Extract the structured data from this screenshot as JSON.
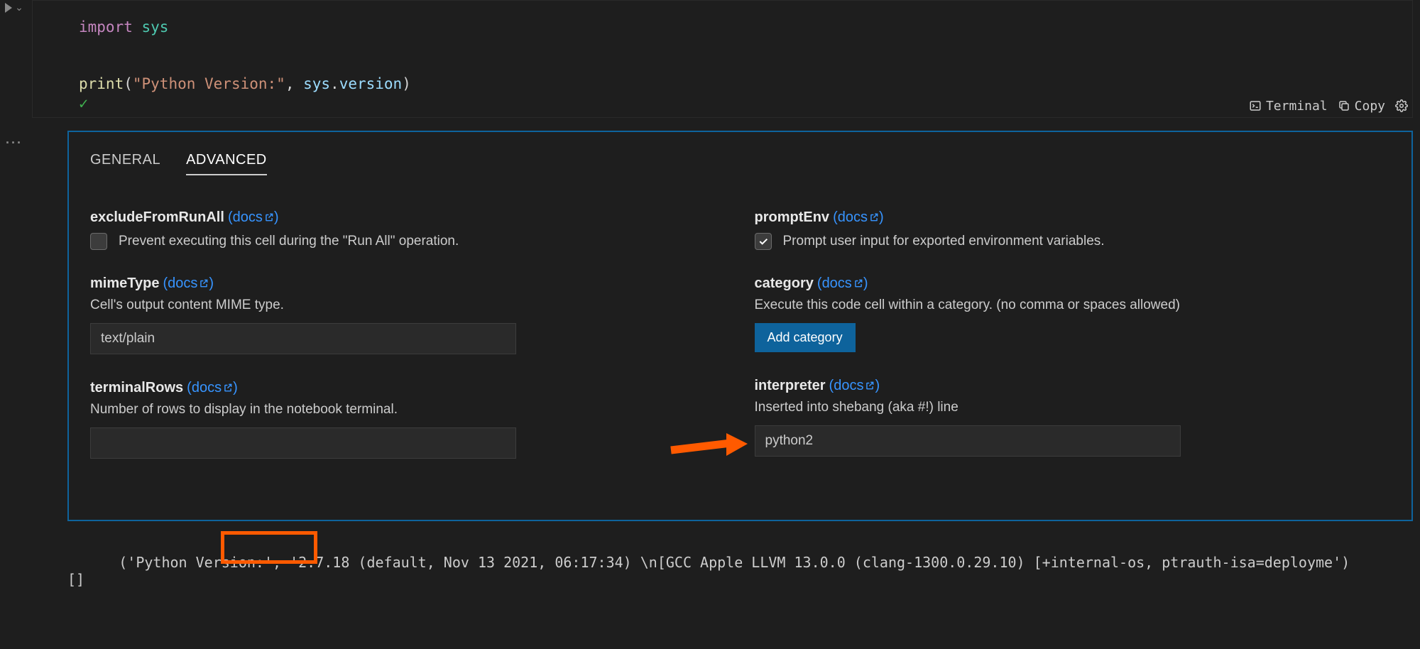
{
  "gutter": {
    "play_label": "run",
    "dropdown_label": "run-options"
  },
  "code": {
    "line1_kw": "import",
    "line1_mod": "sys",
    "line2_fn": "print",
    "line2_str": "\"Python Version:\"",
    "line2_var": "sys",
    "line2_attr": "version"
  },
  "cell_actions": {
    "terminal": "Terminal",
    "copy": "Copy"
  },
  "tabs": {
    "general": "GENERAL",
    "advanced": "ADVANCED"
  },
  "docs_label": "docs",
  "left": {
    "excludeFromRunAll": {
      "title": "excludeFromRunAll",
      "desc": "Prevent executing this cell during the \"Run All\" operation.",
      "checked": false
    },
    "mimeType": {
      "title": "mimeType",
      "desc": "Cell's output content MIME type.",
      "value": "text/plain"
    },
    "terminalRows": {
      "title": "terminalRows",
      "desc": "Number of rows to display in the notebook terminal.",
      "value": ""
    }
  },
  "right": {
    "promptEnv": {
      "title": "promptEnv",
      "desc": "Prompt user input for exported environment variables.",
      "checked": true
    },
    "category": {
      "title": "category",
      "desc": "Execute this code cell within a category. (no comma or spaces allowed)",
      "button": "Add category"
    },
    "interpreter": {
      "title": "interpreter",
      "desc": "Inserted into shebang (aka #!) line",
      "value": "python2"
    }
  },
  "output": {
    "line1": "('Python Version:', '2.7.18 (default, Nov 13 2021, 06:17:34) \\n[GCC Apple LLVM 13.0.0 (clang-1300.0.29.10) [+internal-os, ptrauth-isa=deployme')",
    "line2": "[]",
    "highlight_value": "'2.7.18"
  },
  "annotations": {
    "arrow_points_to": "interpreter-input",
    "box_highlights": "python-version-in-output"
  }
}
